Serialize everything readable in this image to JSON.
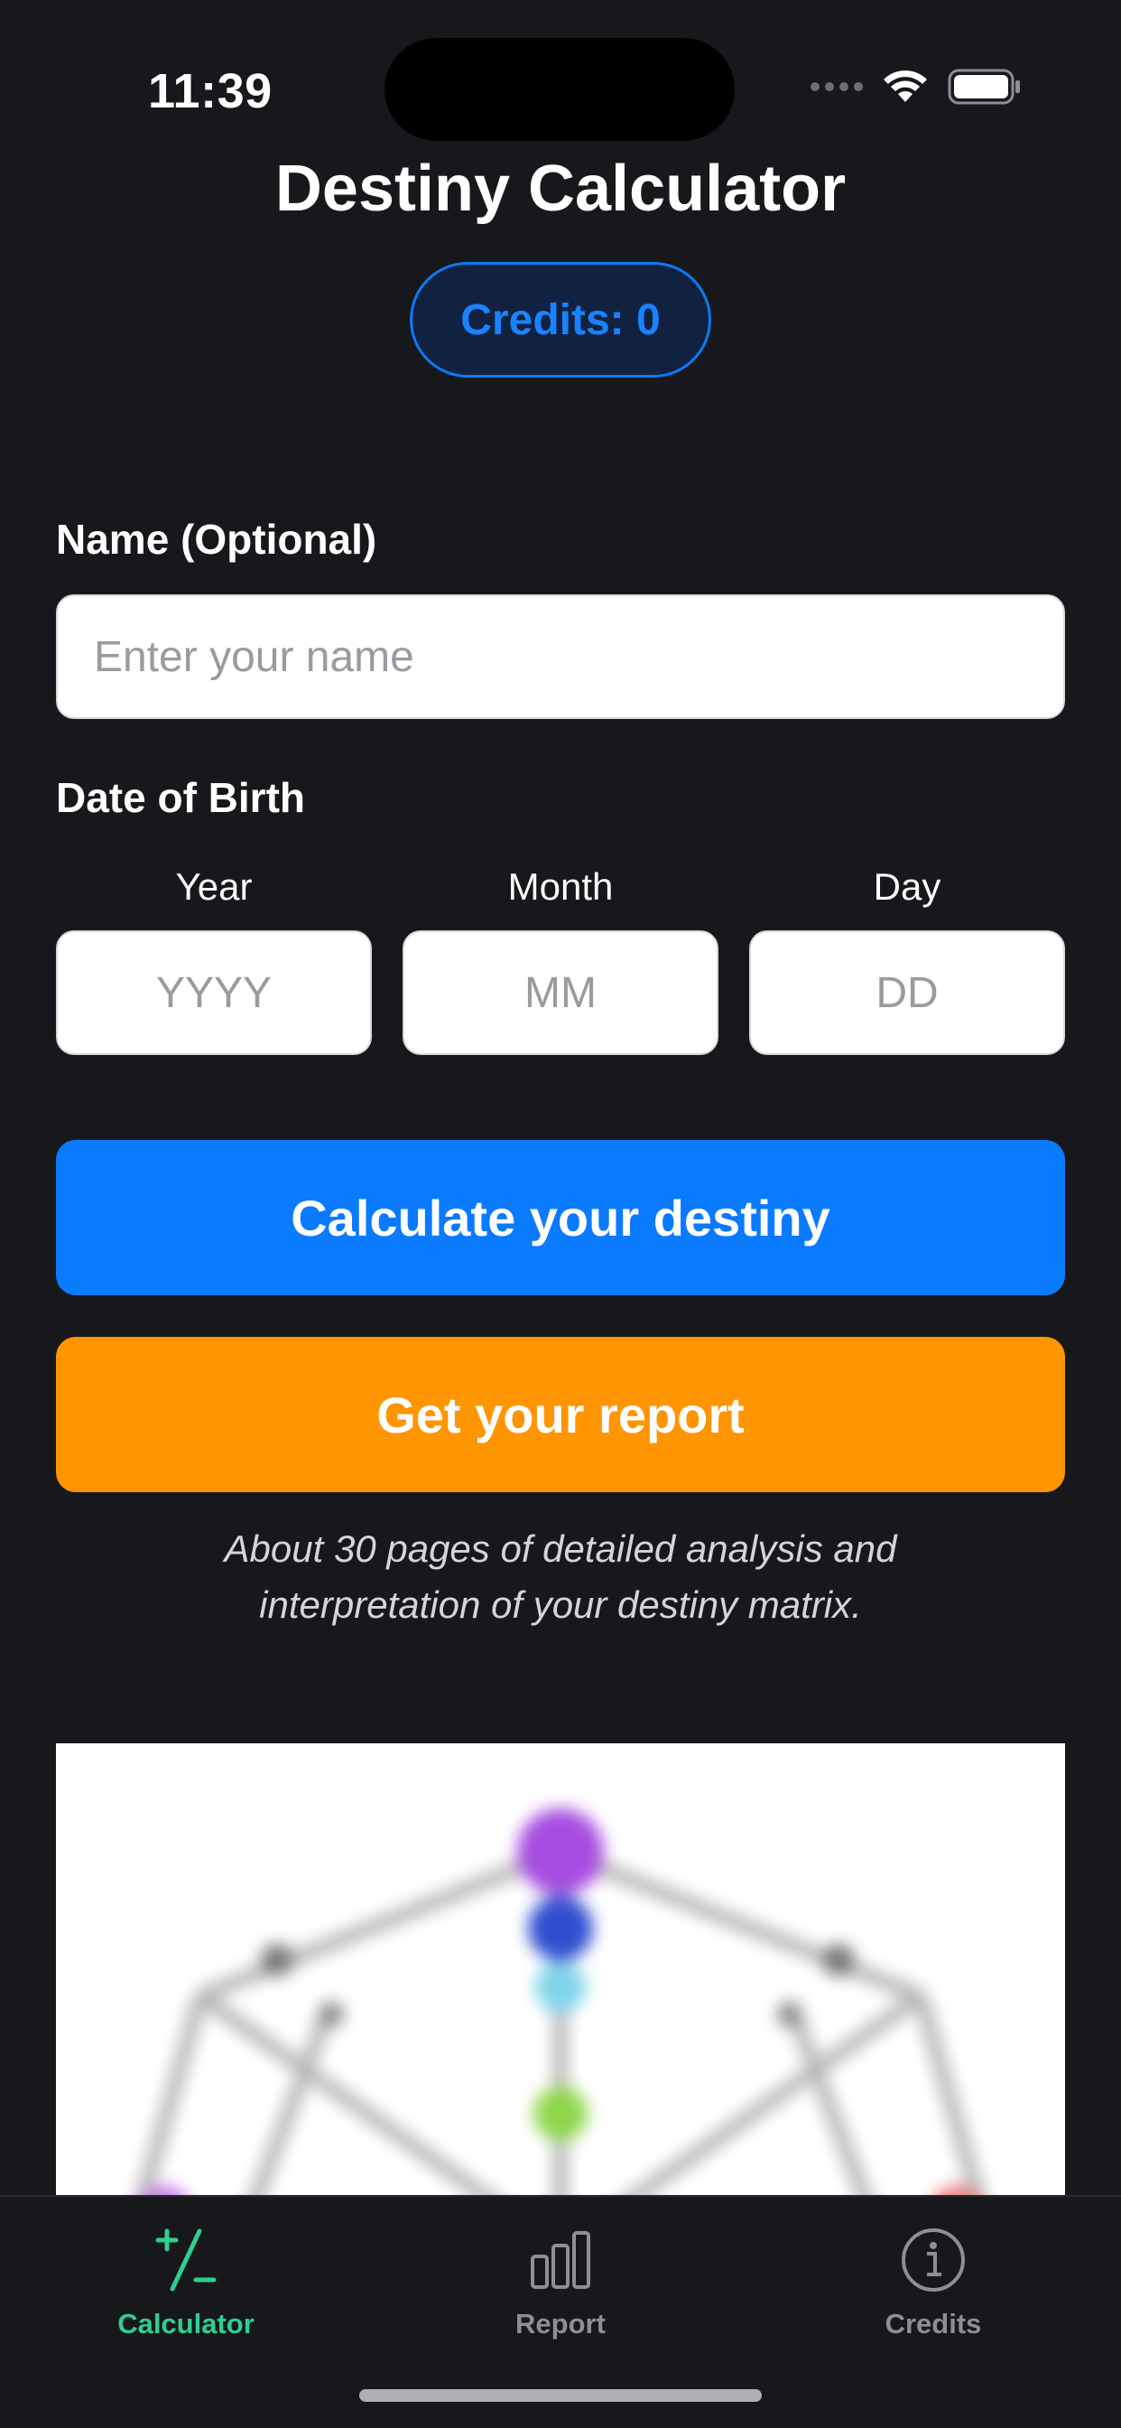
{
  "status_bar": {
    "time": "11:39"
  },
  "header": {
    "title": "Destiny Calculator",
    "credits_label": "Credits: 0"
  },
  "form": {
    "name_label": "Name (Optional)",
    "name_placeholder": "Enter your name",
    "name_value": "",
    "dob_label": "Date of Birth",
    "year_label": "Year",
    "year_placeholder": "YYYY",
    "month_label": "Month",
    "month_placeholder": "MM",
    "day_label": "Day",
    "day_placeholder": "DD"
  },
  "actions": {
    "calculate_label": "Calculate your destiny",
    "report_label": "Get your report",
    "report_note_line1": "About 30 pages of detailed analysis and",
    "report_note_line2": "interpretation of your destiny matrix."
  },
  "tab_bar": {
    "active": "calculator",
    "tabs": [
      {
        "label": "Calculator",
        "icon": "plus-minus-icon"
      },
      {
        "label": "Report",
        "icon": "bar-chart-icon"
      },
      {
        "label": "Credits",
        "icon": "info-circle-icon"
      }
    ]
  },
  "colors": {
    "background": "#17181b",
    "accent_blue": "#0a7aff",
    "accent_orange": "#ff9500",
    "active_tab": "#2ecf8f",
    "inactive_tab": "#8e8e93"
  }
}
